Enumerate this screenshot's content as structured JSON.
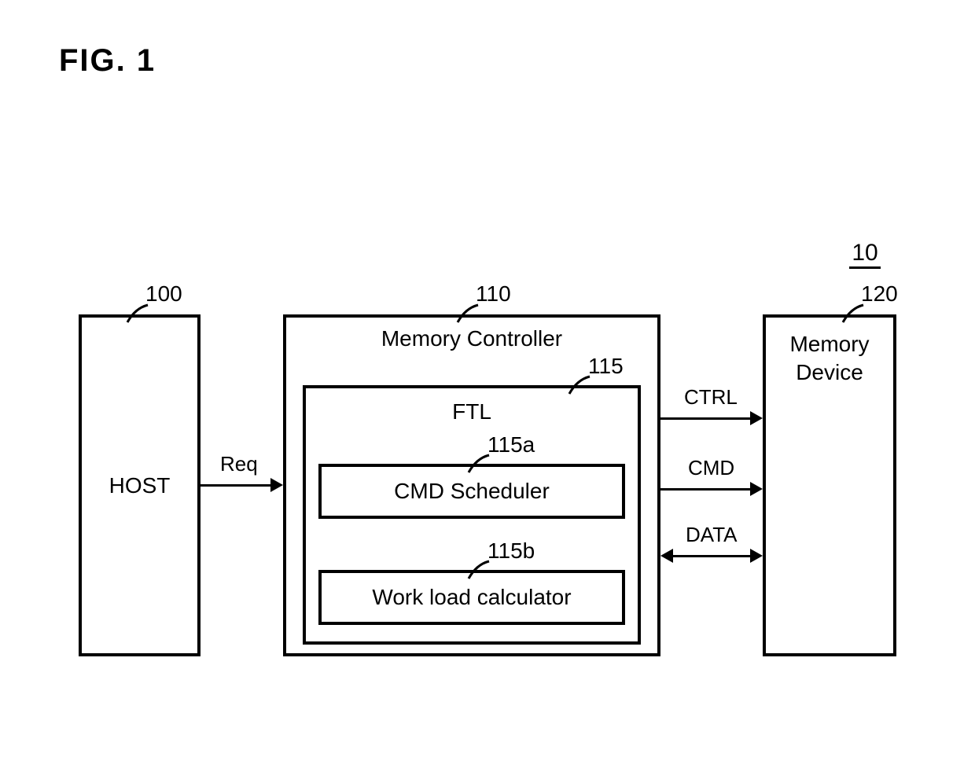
{
  "figure_label": "FIG.  1",
  "system_ref": "10",
  "host": {
    "ref": "100",
    "label": "HOST"
  },
  "controller": {
    "ref": "110",
    "title": "Memory Controller",
    "ftl": {
      "ref": "115",
      "title": "FTL",
      "cmd_scheduler": {
        "ref": "115a",
        "label": "CMD Scheduler"
      },
      "work_load": {
        "ref": "115b",
        "label": "Work load calculator"
      }
    }
  },
  "memory_device": {
    "ref": "120",
    "label_line1": "Memory",
    "label_line2": "Device"
  },
  "signals": {
    "req": "Req",
    "ctrl": "CTRL",
    "cmd": "CMD",
    "data": "DATA"
  }
}
